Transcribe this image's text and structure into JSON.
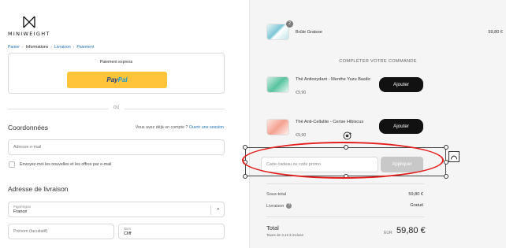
{
  "brand": {
    "name": "MINIWEIGHT"
  },
  "breadcrumb": {
    "items": [
      {
        "label": "Panier",
        "state": "link"
      },
      {
        "label": "Informations",
        "state": "current"
      },
      {
        "label": "Livraison",
        "state": "link"
      },
      {
        "label": "Paiement",
        "state": "link"
      }
    ]
  },
  "express": {
    "title": "Paiement express",
    "paypal_label_1": "Pay",
    "paypal_label_2": "Pal"
  },
  "divider_text": "OU",
  "contact": {
    "title": "Coordonnées",
    "login_prompt": "Vous avez déjà un compte ?",
    "login_link": "Ouvrir une session",
    "email_placeholder": "Adresse e-mail",
    "newsletter_label": "Envoyez-moi les nouvelles et les offres par e-mail"
  },
  "shipping": {
    "title": "Adresse de livraison",
    "country_label": "Pays/région",
    "country_value": "France",
    "firstname_placeholder": "Prénom (facultatif)",
    "lastname_label": "Nom",
    "lastname_value": "Cliff"
  },
  "cart": {
    "item": {
      "name": "Brûle Graisse",
      "price": "59,80 €",
      "quantity": "2"
    }
  },
  "upsell": {
    "title": "COMPLÉTER VOTRE COMMANDE",
    "items": [
      {
        "name": "Thé Antioxydant - Menthe Yuzu Basilic",
        "price": "€9,90",
        "button": "Ajouter"
      },
      {
        "name": "Thé Anti-Cellulite - Cerise Hibiscus",
        "price": "€9,90",
        "button": "Ajouter"
      }
    ]
  },
  "discount": {
    "placeholder": "Carte-cadeau ou code promo",
    "apply_label": "Appliquer"
  },
  "summary": {
    "subtotal_label": "Sous-total",
    "subtotal_value": "59,80 €",
    "shipping_label": "Livraison",
    "shipping_value": "Gratuit",
    "total_label": "Total",
    "tax_note": "Taxes de 3,12 € incluse",
    "currency": "EUR",
    "total_value": "59,80 €"
  },
  "colors": {
    "accent_link": "#1f6fb5",
    "paypal_yellow": "#ffc439",
    "annotation_red": "#e41d1d",
    "button_black": "#111111",
    "apply_disabled": "#c8c8c8"
  }
}
